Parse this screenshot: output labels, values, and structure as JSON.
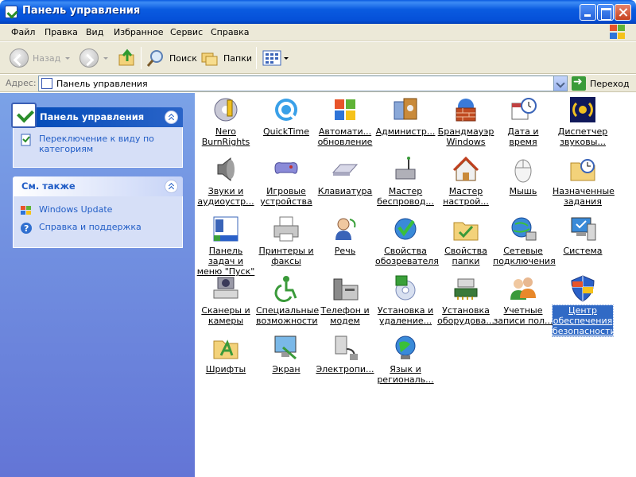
{
  "window": {
    "title": "Панель управления"
  },
  "menu": [
    "Файл",
    "Правка",
    "Вид",
    "Избранное",
    "Сервис",
    "Справка"
  ],
  "toolbar": {
    "back": "Назад",
    "search": "Поиск",
    "folders": "Папки"
  },
  "address": {
    "label": "Адрес:",
    "value": "Панель управления",
    "go": "Переход"
  },
  "taskpane": {
    "main_title": "Панель управления",
    "switch_link": "Переключение к виду по категориям",
    "see_also_title": "См. также",
    "links": [
      "Windows Update",
      "Справка и поддержка"
    ]
  },
  "items": [
    {
      "label": "Nero BurnRights",
      "icon": "nero-key-icon"
    },
    {
      "label": "QuickTime",
      "icon": "quicktime-icon"
    },
    {
      "label": "Автомати... обновление",
      "icon": "windows-update-icon"
    },
    {
      "label": "Администр...",
      "icon": "admin-tools-icon"
    },
    {
      "label": "Брандмауэр Windows",
      "icon": "firewall-icon"
    },
    {
      "label": "Дата и время",
      "icon": "date-time-icon"
    },
    {
      "label": "Диспетчер звуковы...",
      "icon": "sound-manager-icon"
    },
    {
      "label": "Звуки и аудиоустр...",
      "icon": "speaker-icon"
    },
    {
      "label": "Игровые устройства",
      "icon": "gamepad-icon"
    },
    {
      "label": "Клавиатура",
      "icon": "keyboard-icon"
    },
    {
      "label": "Мастер беспровод...",
      "icon": "wireless-icon"
    },
    {
      "label": "Мастер настрой...",
      "icon": "network-wizard-icon"
    },
    {
      "label": "Мышь",
      "icon": "mouse-icon"
    },
    {
      "label": "Назначенные задания",
      "icon": "scheduled-tasks-icon"
    },
    {
      "label": "Панель задач и меню \"Пуск\"",
      "icon": "taskbar-icon"
    },
    {
      "label": "Принтеры и факсы",
      "icon": "printer-icon"
    },
    {
      "label": "Речь",
      "icon": "speech-icon"
    },
    {
      "label": "Свойства обозревателя",
      "icon": "internet-options-icon"
    },
    {
      "label": "Свойства папки",
      "icon": "folder-options-icon"
    },
    {
      "label": "Сетевые подключения",
      "icon": "network-connections-icon"
    },
    {
      "label": "Система",
      "icon": "system-icon"
    },
    {
      "label": "Сканеры и камеры",
      "icon": "scanner-camera-icon"
    },
    {
      "label": "Специальные возможности",
      "icon": "accessibility-icon"
    },
    {
      "label": "Телефон и модем",
      "icon": "phone-modem-icon"
    },
    {
      "label": "Установка и удаление...",
      "icon": "add-remove-programs-icon"
    },
    {
      "label": "Установка оборудова...",
      "icon": "add-hardware-icon"
    },
    {
      "label": "Учетные записи пол...",
      "icon": "user-accounts-icon"
    },
    {
      "label": "Центр обеспечения безопасности",
      "icon": "security-center-icon",
      "selected": true
    },
    {
      "label": "Шрифты",
      "icon": "fonts-icon"
    },
    {
      "label": "Экран",
      "icon": "display-icon"
    },
    {
      "label": "Электропи...",
      "icon": "power-options-icon"
    },
    {
      "label": "Язык и региональ...",
      "icon": "regional-options-icon"
    }
  ],
  "colors": {
    "titlebar": "#0a5be0",
    "taskpane": "#6375d6",
    "link": "#215dc6",
    "selection": "#316ac5"
  }
}
